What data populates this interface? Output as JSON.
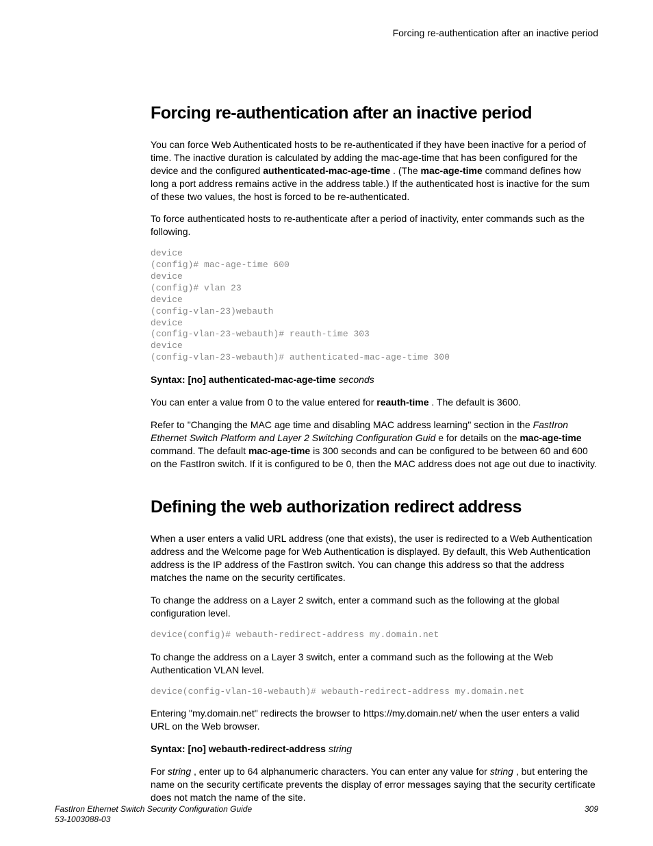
{
  "header": {
    "running_title": "Forcing re-authentication after an inactive period"
  },
  "sec1": {
    "title": "Forcing re-authentication after an inactive period",
    "p1a": "You can force Web Authenticated hosts to be re-authenticated if they have been inactive for a period of time. The inactive duration is calculated by adding the mac-age-time that has been configured for the device and the configured ",
    "p1b_bold": "authenticated-mac-age-time",
    "p1c": " . (The ",
    "p1d_bold": "mac-age-time",
    "p1e": " command defines how long a port address remains active in the address table.) If the authenticated host is inactive for the sum of these two values, the host is forced to be re-authenticated.",
    "p2": "To force authenticated hosts to re-authenticate after a period of inactivity, enter commands such as the following.",
    "code1": "device\n(config)# mac-age-time 600\ndevice\n(config)# vlan 23\ndevice\n(config-vlan-23)webauth\ndevice\n(config-vlan-23-webauth)# reauth-time 303\ndevice\n(config-vlan-23-webauth)# authenticated-mac-age-time 300",
    "syntax1_bold": "Syntax: [no] authenticated-mac-age-time",
    "syntax1_italic": " seconds",
    "p3a": "You can enter a value from 0 to the value entered for ",
    "p3b_bold": "reauth-time",
    "p3c": " . The default is 3600.",
    "p4a": "Refer to \"Changing the MAC age time and disabling MAC address learning\" section in the ",
    "p4b_italic": "FastIron Ethernet Switch Platform and Layer 2 Switching Configuration Guid",
    "p4c": " e for details on the ",
    "p4d_bold": "mac-age-time",
    "p4e": " command. The default ",
    "p4f_bold": "mac-age-time",
    "p4g": " is 300 seconds and can be configured to be between 60 and 600 on the FastIron switch. If it is configured to be 0, then the MAC address does not age out due to inactivity."
  },
  "sec2": {
    "title": "Defining the web authorization redirect address",
    "p1": "When a user enters a valid URL address (one that exists), the user is redirected to a Web Authentication address and the Welcome page for Web Authentication is displayed. By default, this Web Authentication address is the IP address of the FastIron switch. You can change this address so that the address matches the name on the security certificates.",
    "p2": "To change the address on a Layer 2 switch, enter a command such as the following at the global configuration level.",
    "code1": "device(config)# webauth-redirect-address my.domain.net",
    "p3": "To change the address on a Layer 3 switch, enter a command such as the following at the Web Authentication VLAN level.",
    "code2": "device(config-vlan-10-webauth)# webauth-redirect-address my.domain.net",
    "p4": "Entering \"my.domain.net\" redirects the browser to https://my.domain.net/ when the user enters a valid URL on the Web browser.",
    "syntax1_bold": "Syntax: [no] webauth-redirect-address",
    "syntax1_italic": " string",
    "p5a": "For ",
    "p5b_italic": "string",
    "p5c": " , enter up to 64 alphanumeric characters. You can enter any value for ",
    "p5d_italic": "string",
    "p5e": " , but entering the name on the security certificate prevents the display of error messages saying that the security certificate does not match the name of the site."
  },
  "footer": {
    "doc_title": "FastIron Ethernet Switch Security Configuration Guide",
    "doc_number": "53-1003088-03",
    "page_number": "309"
  }
}
